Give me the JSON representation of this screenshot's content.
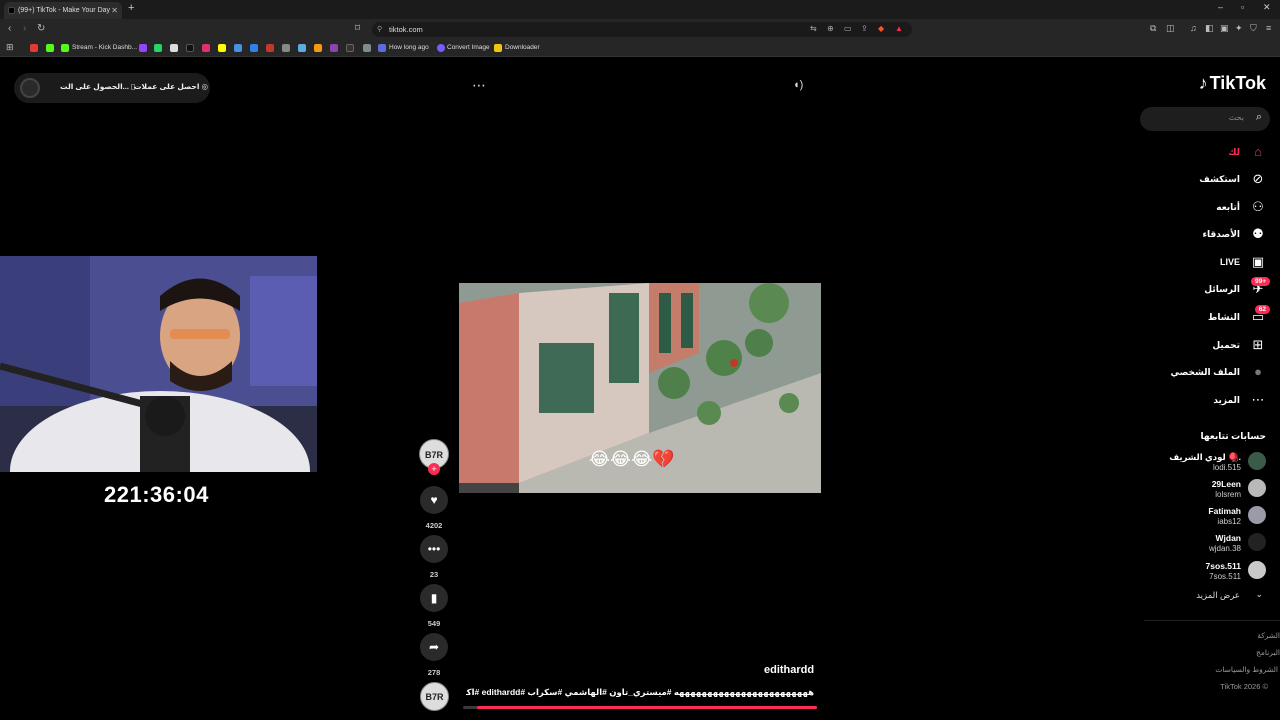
{
  "browser": {
    "tab_title": "(99+) TikTok - Make Your Day",
    "new_tab": "+",
    "url": "tiktok.com",
    "bookmarks": [
      "Stream - Kick Dashb...",
      "How long ago",
      "Convert Image",
      "Downloader"
    ]
  },
  "promo": {
    "get_coins": "احصل على عملات",
    "get_app": "الحصول على الت..."
  },
  "player": {
    "more_icon": "⋯",
    "volume_icon": "volume-icon",
    "emoji_overlay": "😂😂😂💔",
    "author": "edithardd",
    "caption": "ههههههههههههههههههههههههه #ميستري_تاون #الهاشمي #سكراب #edithardd #اكسبلور",
    "avatar_text": "B7R",
    "progress_fraction": 0.96,
    "actions": {
      "likes": "4202",
      "comments": "23",
      "saves": "549",
      "shares": "278"
    }
  },
  "webcam": {
    "timer": "221:36:04"
  },
  "sidebar": {
    "logo": "TikTok",
    "search_placeholder": "بحث",
    "nav": [
      {
        "label": "لك",
        "icon": "home-icon"
      },
      {
        "label": "استكشف",
        "icon": "compass-icon"
      },
      {
        "label": "أتابعه",
        "icon": "following-icon"
      },
      {
        "label": "الأصدقاء",
        "icon": "friends-icon"
      },
      {
        "label": "LIVE",
        "icon": "live-icon"
      },
      {
        "label": "الرسائل",
        "icon": "messages-icon",
        "badge": "99+"
      },
      {
        "label": "النشاط",
        "icon": "activity-icon",
        "badge": "62"
      },
      {
        "label": "تحميل",
        "icon": "upload-icon"
      },
      {
        "label": "الملف الشخصي",
        "icon": "profile-icon"
      },
      {
        "label": "المزيد",
        "icon": "more-icon"
      }
    ],
    "following_title": "حسابات تتابعها",
    "following": [
      {
        "name": "لودي الشريف 🪀.",
        "user": "lodi.515"
      },
      {
        "name": "29Leen",
        "user": "lolsrem"
      },
      {
        "name": "Fatimah",
        "user": "iabs12"
      },
      {
        "name": "Wjdan",
        "user": "wjdan.38"
      },
      {
        "name": "7sos.511",
        "user": "7sos.511"
      }
    ],
    "see_more": "عرض المزيد",
    "footer": [
      "الشركة",
      "البرنامج",
      "الشروط والسياسات",
      "TikTok 2026 ©"
    ]
  },
  "colors": {
    "accent": "#fe2c55",
    "background": "#000000",
    "chrome": "#1f1f1f"
  }
}
